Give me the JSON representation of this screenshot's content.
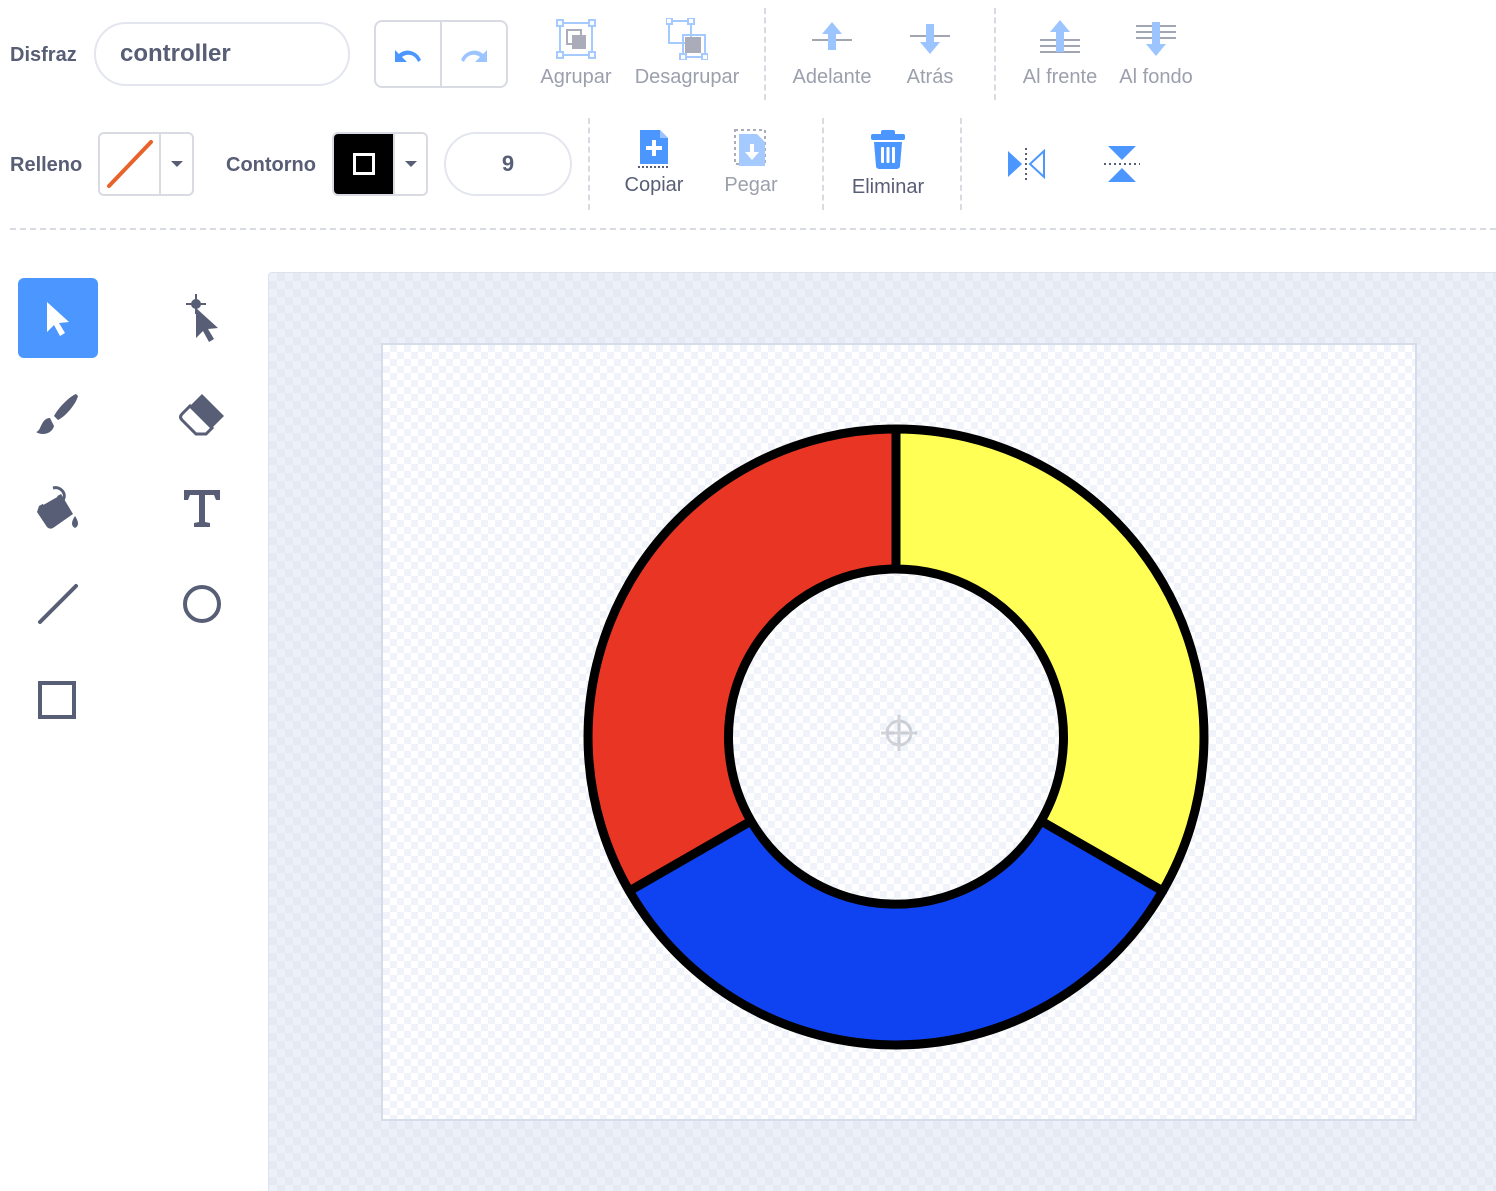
{
  "costume": {
    "label": "Disfraz",
    "name_value": "controller"
  },
  "toolbar": {
    "group": "Agrupar",
    "ungroup": "Desagrupar",
    "forward": "Adelante",
    "backward": "Atrás",
    "front": "Al frente",
    "back": "Al fondo"
  },
  "fill": {
    "label": "Relleno",
    "color": "#e8632c",
    "is_none": true
  },
  "outline": {
    "label": "Contorno",
    "color": "#000000",
    "size": "9"
  },
  "actions": {
    "copy": "Copiar",
    "paste": "Pegar",
    "delete": "Eliminar"
  },
  "tools": [
    {
      "id": "select",
      "icon": "select-arrow-icon",
      "selected": true
    },
    {
      "id": "reshape",
      "icon": "reshape-icon",
      "selected": false
    },
    {
      "id": "brush",
      "icon": "brush-icon",
      "selected": false
    },
    {
      "id": "eraser",
      "icon": "eraser-icon",
      "selected": false
    },
    {
      "id": "fill",
      "icon": "fill-bucket-icon",
      "selected": false
    },
    {
      "id": "text",
      "icon": "text-icon",
      "selected": false
    },
    {
      "id": "line",
      "icon": "line-icon",
      "selected": false
    },
    {
      "id": "circle",
      "icon": "circle-icon",
      "selected": false
    },
    {
      "id": "rectangle",
      "icon": "rectangle-icon",
      "selected": false
    }
  ],
  "drawing": {
    "shape": "ring of three segments",
    "segments": [
      {
        "name": "yellow",
        "color": "#ffff55"
      },
      {
        "name": "blue",
        "color": "#0f43f2"
      },
      {
        "name": "red",
        "color": "#e83524"
      }
    ],
    "stroke": "#000000"
  },
  "colors": {
    "accent": "#4c97ff",
    "text": "#575e75",
    "disabled": "#9ca0ad"
  }
}
